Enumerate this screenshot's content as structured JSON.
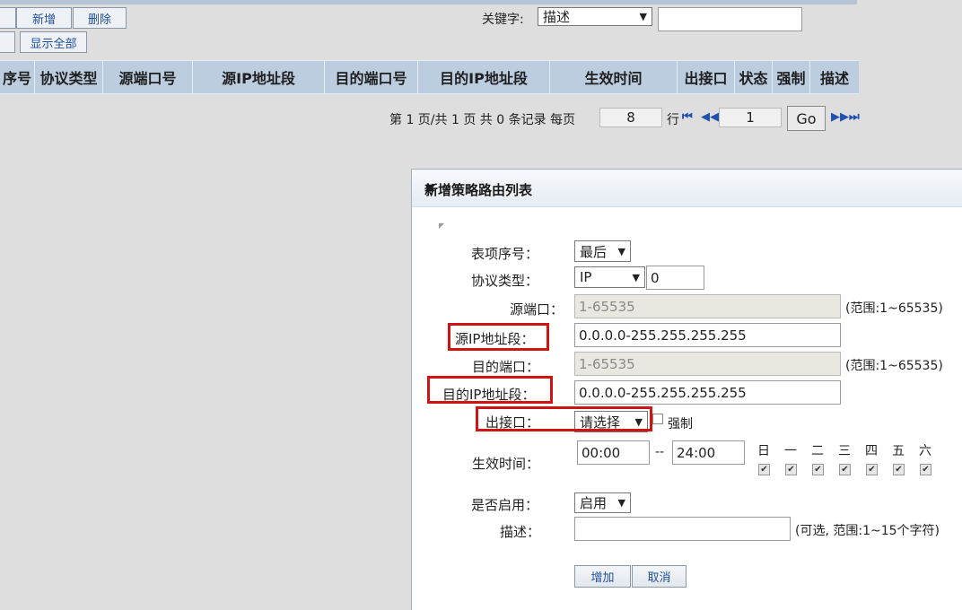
{
  "toolbar": {
    "add_label": "新增",
    "delete_label": "删除",
    "show_all_label": "显示全部",
    "keyword_label": "关键字:",
    "keyword_select_value": "描述",
    "keyword_input_value": ""
  },
  "table": {
    "headers": [
      "序号",
      "协议类型",
      "源端口号",
      "源IP地址段",
      "目的端口号",
      "目的IP地址段",
      "生效时间",
      "出接口",
      "状态",
      "强制",
      "描述"
    ]
  },
  "pager": {
    "summary": "第 1 页/共 1 页 共 0 条记录 每页",
    "per_page": "8",
    "rows_label": "行",
    "page_value": "1",
    "go_label": "Go"
  },
  "dialog": {
    "title": "新增策略路由列表",
    "index_label": "表项序号：",
    "index_value": "最后",
    "protocol_label": "协议类型：",
    "protocol_value": "IP",
    "protocol_number": "0",
    "src_port_label": "源端口：",
    "src_port_value": "1-65535",
    "src_port_hint": "(范围:1~65535)",
    "src_ip_label": "源IP地址段：",
    "src_ip_value": "0.0.0.0-255.255.255.255",
    "dst_port_label": "目的端口：",
    "dst_port_value": "1-65535",
    "dst_port_hint": "(范围:1~65535)",
    "dst_ip_label": "目的IP地址段：",
    "dst_ip_value": "0.0.0.0-255.255.255.255",
    "out_if_label": "出接口：",
    "out_if_value": "请选择",
    "force_label": "强制",
    "time_label": "生效时间：",
    "time_start": "00:00",
    "time_sep": "--",
    "time_end": "24:00",
    "days": [
      "日",
      "一",
      "二",
      "三",
      "四",
      "五",
      "六"
    ],
    "enable_label": "是否启用：",
    "enable_value": "启用",
    "desc_label": "描述：",
    "desc_value": "",
    "desc_hint": "(可选, 范围:1~15个字符)",
    "add_button": "增加",
    "cancel_button": "取消"
  }
}
